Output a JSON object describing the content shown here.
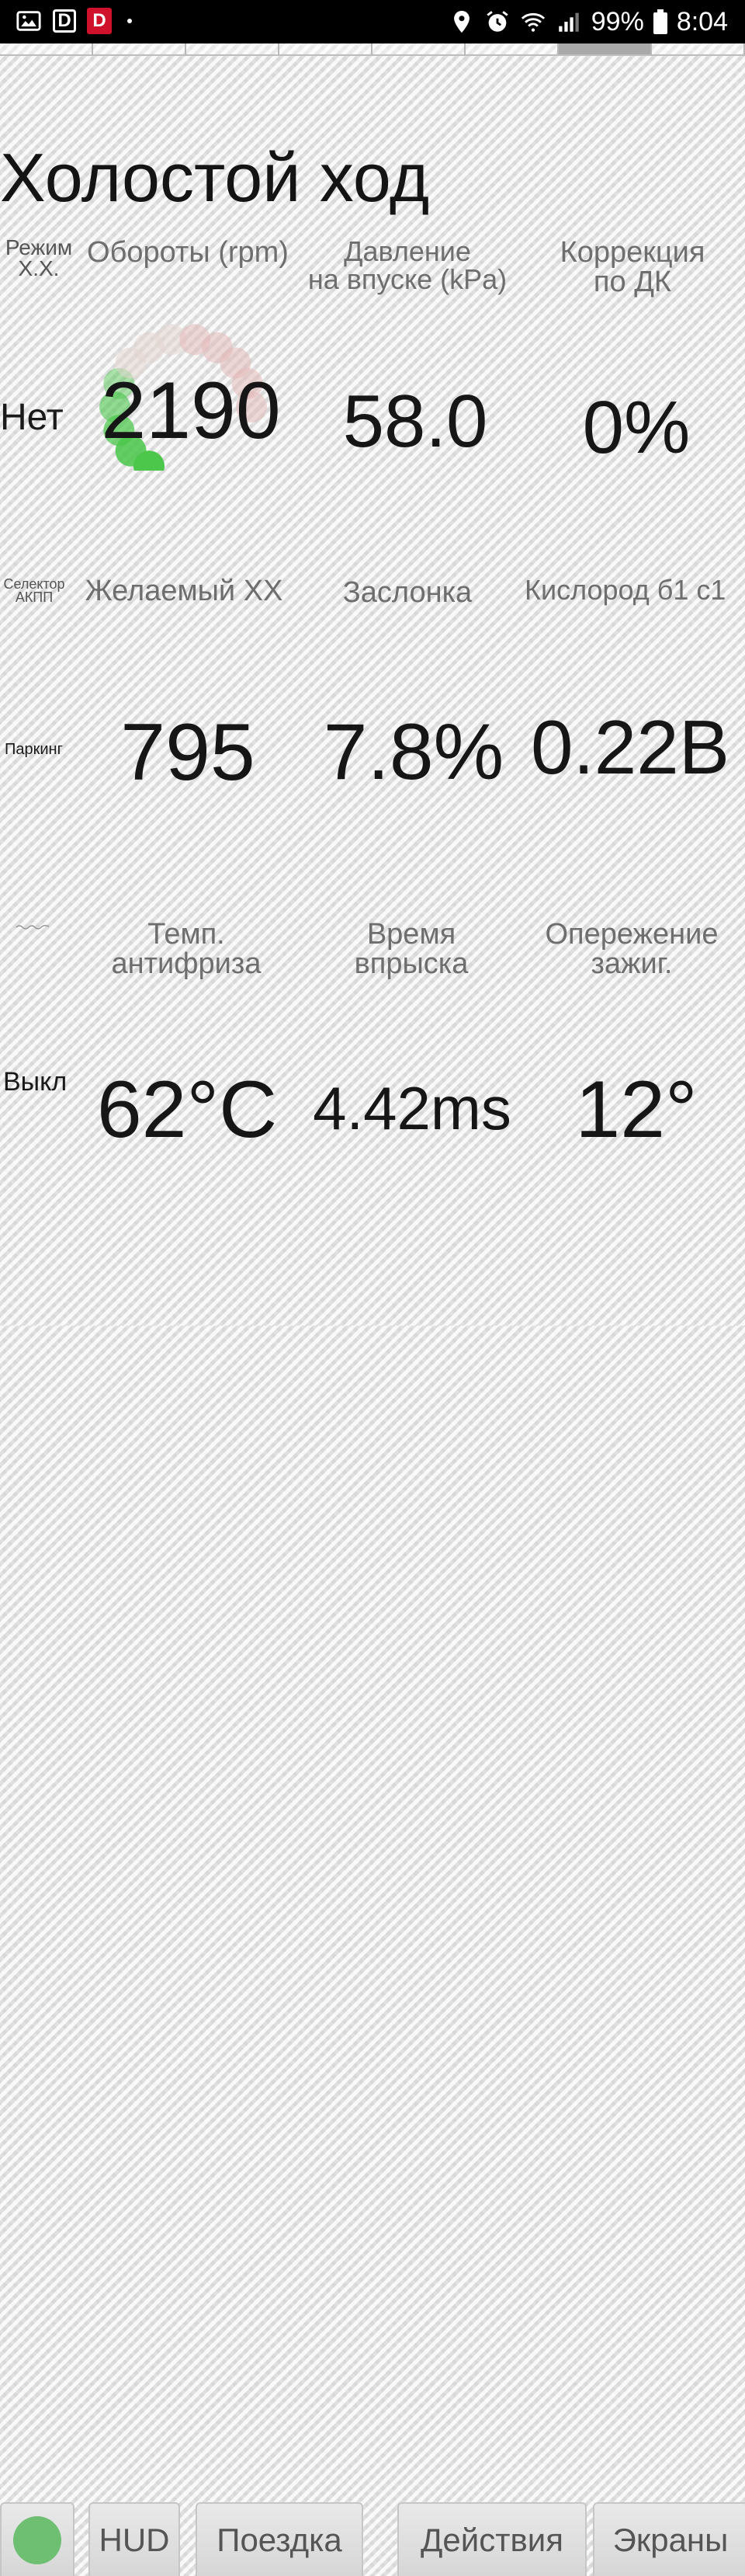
{
  "status_bar": {
    "d_label": "D",
    "d_red_label": "D",
    "battery": "99%",
    "time": "8:04"
  },
  "title": "Холостой ход",
  "cells": {
    "idle_mode_label": "Режим Х.Х.",
    "idle_mode_value": "Нет",
    "rpm_label": "Обороты (rpm)",
    "rpm_value": "2190",
    "intake_pressure_label_1": "Давление",
    "intake_pressure_label_2": "на впуске (kPa)",
    "intake_pressure_value": "58.0",
    "correction_label_1": "Коррекция",
    "correction_label_2": "по ДК",
    "correction_value": "0%",
    "gear_selector_label": "Селектор АКПП",
    "gear_selector_value": "Паркинг",
    "desired_idle_label": "Желаемый ХХ",
    "desired_idle_value": "795",
    "throttle_label": "Заслонка",
    "throttle_value": "7.8%",
    "oxygen_label": "Кислород б1 с1",
    "oxygen_value": "0.22В",
    "mini_label": "",
    "mini_value": "Выкл",
    "coolant_label_1": "Темп.",
    "coolant_label_2": "антифриза",
    "coolant_value": "62°C",
    "injection_label_1": "Время",
    "injection_label_2": "впрыска",
    "injection_value": "4.42ms",
    "timing_label_1": "Опережение",
    "timing_label_2": "зажиг.",
    "timing_value": "12°"
  },
  "gauge": {
    "rpm": 2190,
    "max": 6000,
    "on_color": "#4cc74c",
    "off_color": "#e8c6c6"
  },
  "tabs": {
    "hud": "HUD",
    "trip": "Поездка",
    "actions": "Действия",
    "screens": "Экраны"
  },
  "page_indicator": {
    "pages": 8,
    "active_index": 6
  },
  "colors": {
    "status_dot": "#6fbf73"
  }
}
